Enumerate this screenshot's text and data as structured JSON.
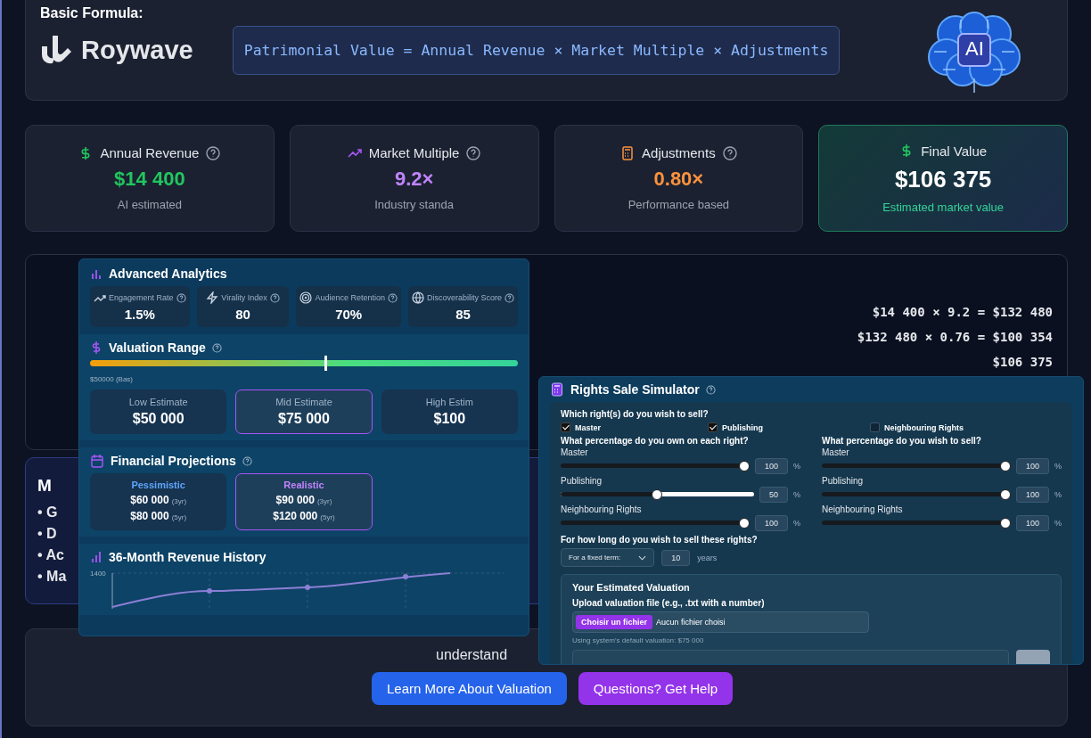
{
  "header": {
    "label": "Basic Formula:",
    "logo": "Roywave",
    "formula": "Patrimonial Value = Annual Revenue × Market Multiple × Adjustments",
    "ai_badge": "AI"
  },
  "metrics": [
    {
      "kind": "revenue",
      "label": "Annual Revenue",
      "value": "$14 400",
      "note": "AI estimated",
      "color": "#22c55e"
    },
    {
      "kind": "multiple",
      "label": "Market Multiple",
      "value": "9.2×",
      "note": "Industry standa",
      "color": "#c084fc"
    },
    {
      "kind": "adjustments",
      "label": "Adjustments",
      "value": "0.80×",
      "note": "Performance based",
      "color": "#fb923c"
    },
    {
      "kind": "final",
      "label": "Final Value",
      "value": "$106 375",
      "note": "Estimated market value",
      "color": "#ffffff"
    }
  ],
  "calculation": {
    "lines": [
      "$14 400 × 9.2 = $132 480",
      "$132 480 × 0.76 = $100 354",
      "$106 375"
    ]
  },
  "methodology": {
    "heading": "M",
    "items": [
      "• G",
      "• D",
      "• Ac",
      "• Ma"
    ]
  },
  "cta": {
    "text": "understand",
    "buttons": [
      {
        "label": "Learn More About Valuation",
        "kind": "primary"
      },
      {
        "label": "Questions? Get Help",
        "kind": "secondary"
      }
    ]
  },
  "analytics": {
    "title": "Advanced Analytics",
    "metrics": [
      {
        "kind": "engagement",
        "label": "Engagement Rate",
        "value": "1.5%"
      },
      {
        "kind": "virality",
        "label": "Virality Index",
        "value": "80"
      },
      {
        "kind": "retention",
        "label": "Audience Retention",
        "value": "70%"
      },
      {
        "kind": "discoverability",
        "label": "Discoverability Score",
        "value": "85"
      }
    ],
    "valuation_range": {
      "title": "Valuation Range",
      "scale_label": "$50000 (Bas)",
      "level": 0.55,
      "estimates": [
        {
          "label": "Low Estimate",
          "value": "$50 000",
          "selected": false
        },
        {
          "label": "Mid Estimate",
          "value": "$75 000",
          "selected": true
        },
        {
          "label": "High Estim",
          "value": "$100",
          "selected": false
        }
      ]
    },
    "projections": {
      "title": "Financial Projections",
      "scenarios": [
        {
          "label": "Pessimistic",
          "color": "#60a5fa",
          "selected": false,
          "three_year": "$60 000",
          "three_year_unit": "(3yr)",
          "five_year": "$80 000",
          "five_year_unit": "(5yr)"
        },
        {
          "label": "Realistic",
          "color": "#c084fc",
          "selected": true,
          "three_year": "$90 000",
          "three_year_unit": "(3yr)",
          "five_year": "$120 000",
          "five_year_unit": "(5yr)"
        }
      ]
    },
    "history": {
      "title": "36-Month Revenue History",
      "y_tick": "1400"
    }
  },
  "simulator": {
    "title": "Rights Sale Simulator",
    "question": "Which right(s) do you wish to sell?",
    "rights": [
      {
        "label": "Master",
        "checked": true
      },
      {
        "label": "Publishing",
        "checked": true
      },
      {
        "label": "Neighbouring Rights",
        "checked": false
      }
    ],
    "own": {
      "question": "What percentage do you own on each right?",
      "rows": [
        {
          "label": "Master",
          "value": "100",
          "unit": "%",
          "level": 1
        },
        {
          "label": "Publishing",
          "value": "50",
          "unit": "%",
          "level": 0.5
        },
        {
          "label": "Neighbouring Rights",
          "value": "100",
          "unit": "%",
          "level": 1
        }
      ]
    },
    "sell": {
      "question": "What percentage do you wish to sell?",
      "rows": [
        {
          "label": "Master",
          "value": "100",
          "unit": "%",
          "level": 1
        },
        {
          "label": "Publishing",
          "value": "100",
          "unit": "%",
          "level": 1
        },
        {
          "label": "Neighbouring Rights",
          "value": "100",
          "unit": "%",
          "level": 1
        }
      ]
    },
    "duration": {
      "question": "For how long do you wish to sell these rights?",
      "select": "For a fixed term:",
      "years": "10",
      "unit": "years"
    },
    "valuation": {
      "title": "Your Estimated Valuation",
      "upload_label": "Upload valuation file (e.g., .txt with a number)",
      "file_button": "Choisir un fichier",
      "file_status": "Aucun fichier choisi",
      "note": "Using system's default valuation: $75 000"
    }
  }
}
